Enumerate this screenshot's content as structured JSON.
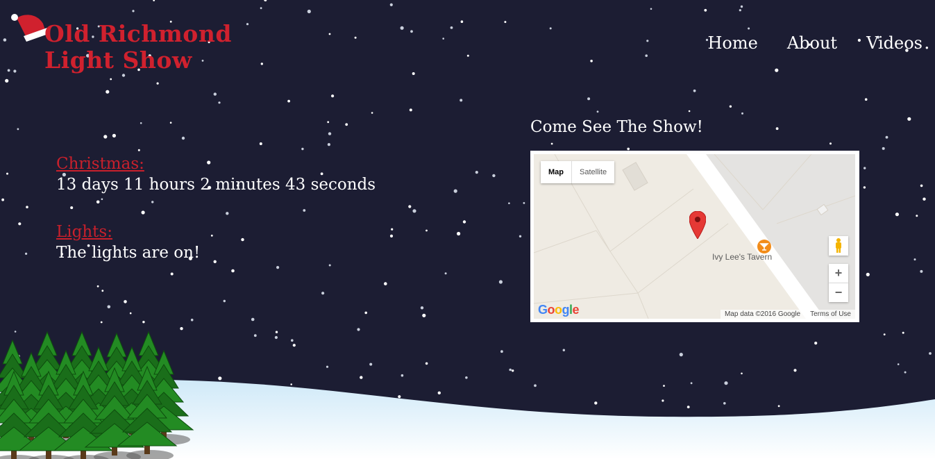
{
  "header": {
    "logo_line1": "Old Richmond",
    "logo_line2": "Light Show"
  },
  "nav": {
    "items": [
      {
        "label": "Home"
      },
      {
        "label": "About"
      },
      {
        "label": "Videos"
      }
    ]
  },
  "countdown": {
    "christmas_label": "Christmas:",
    "christmas_value": "13 days 11 hours 2 minutes 43 seconds",
    "lights_label": "Lights:",
    "lights_value": "The lights are on!"
  },
  "map": {
    "title": "Come See The Show!",
    "type_map": "Map",
    "type_satellite": "Satellite",
    "place_label": "Ivy Lee's Tavern",
    "zoom_in": "+",
    "zoom_out": "−",
    "google_letters": [
      "G",
      "o",
      "o",
      "g",
      "l",
      "e"
    ],
    "attribution": "Map data ©2016 Google",
    "terms": "Terms of Use"
  },
  "colors": {
    "background": "#1c1d33",
    "accent_red": "#d0212e",
    "snow": "#dff1fb",
    "tree": "#1f7a1f"
  },
  "icons": {
    "hat": "santa-hat-icon",
    "pin": "map-pin-icon",
    "bar": "bar-icon",
    "pegman": "pegman-icon"
  }
}
